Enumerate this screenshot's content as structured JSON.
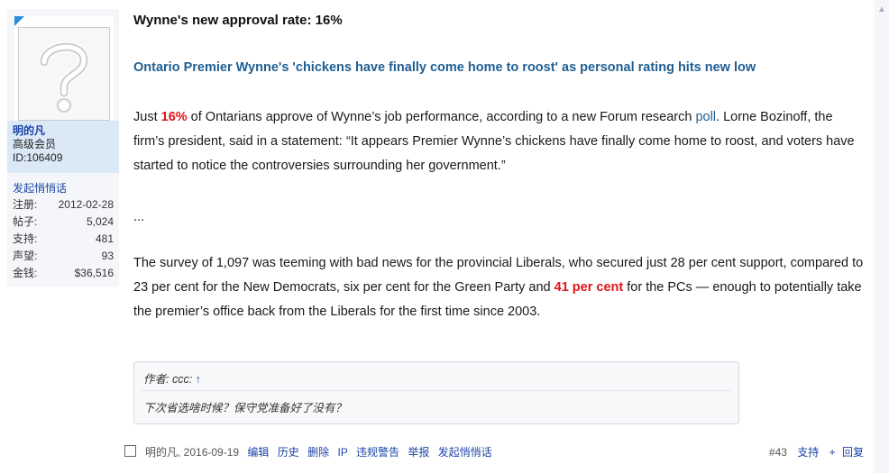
{
  "user": {
    "name": "明的凡",
    "group": "高级会员",
    "id": "ID:106409",
    "pm_link": "发起悄悄话",
    "stats": [
      {
        "label": "注册:",
        "value": "2012-02-28"
      },
      {
        "label": "帖子:",
        "value": "5,024"
      },
      {
        "label": "支持:",
        "value": "481"
      },
      {
        "label": "声望:",
        "value": "93"
      },
      {
        "label": "金钱:",
        "value": "$36,516"
      }
    ]
  },
  "post": {
    "title": "Wynne's new approval rate: 16%",
    "subtitle": "Ontario Premier Wynne's 'chickens have finally come home to roost' as personal rating hits new low",
    "p1": {
      "a": "Just ",
      "b": "16%",
      "c": " of Ontarians approve of Wynne’s job performance, according to a new Forum research ",
      "d": "poll",
      "e": ". Lorne Bozinoff, the firm’s president, said in a statement: “It appears Premier Wynne’s chickens have finally come home to roost, and voters have started to notice the controversies surrounding her government.”"
    },
    "ellipsis": "...",
    "p3": {
      "a": "The survey of 1,097 was teeming with bad news for the provincial Liberals, who secured just 28 per cent support, compared to 23 per cent for the New Democrats, six per cent for the Green Party and ",
      "b": "41 per cent",
      "c": " for the PCs — enough to potentially take the premier’s office back from the Liberals for the first time since 2003."
    },
    "quote": {
      "author": "作者: ccc: ",
      "arrow": "↑",
      "text": "下次省选啥时候？保守党准备好了没有？"
    }
  },
  "footer": {
    "meta": "明的凡, 2016-09-19",
    "actions": [
      "编辑",
      "历史",
      "删除",
      "IP",
      "违规警告",
      "举报",
      "发起悄悄话"
    ],
    "post_number": "#43",
    "support": "支持",
    "plus": "+",
    "reply": "回复"
  },
  "colors": {
    "accent": "#1d44a8",
    "link": "#1f5f93",
    "highlight_red": "#e0141b",
    "user_panel": "#dbe9f7"
  }
}
